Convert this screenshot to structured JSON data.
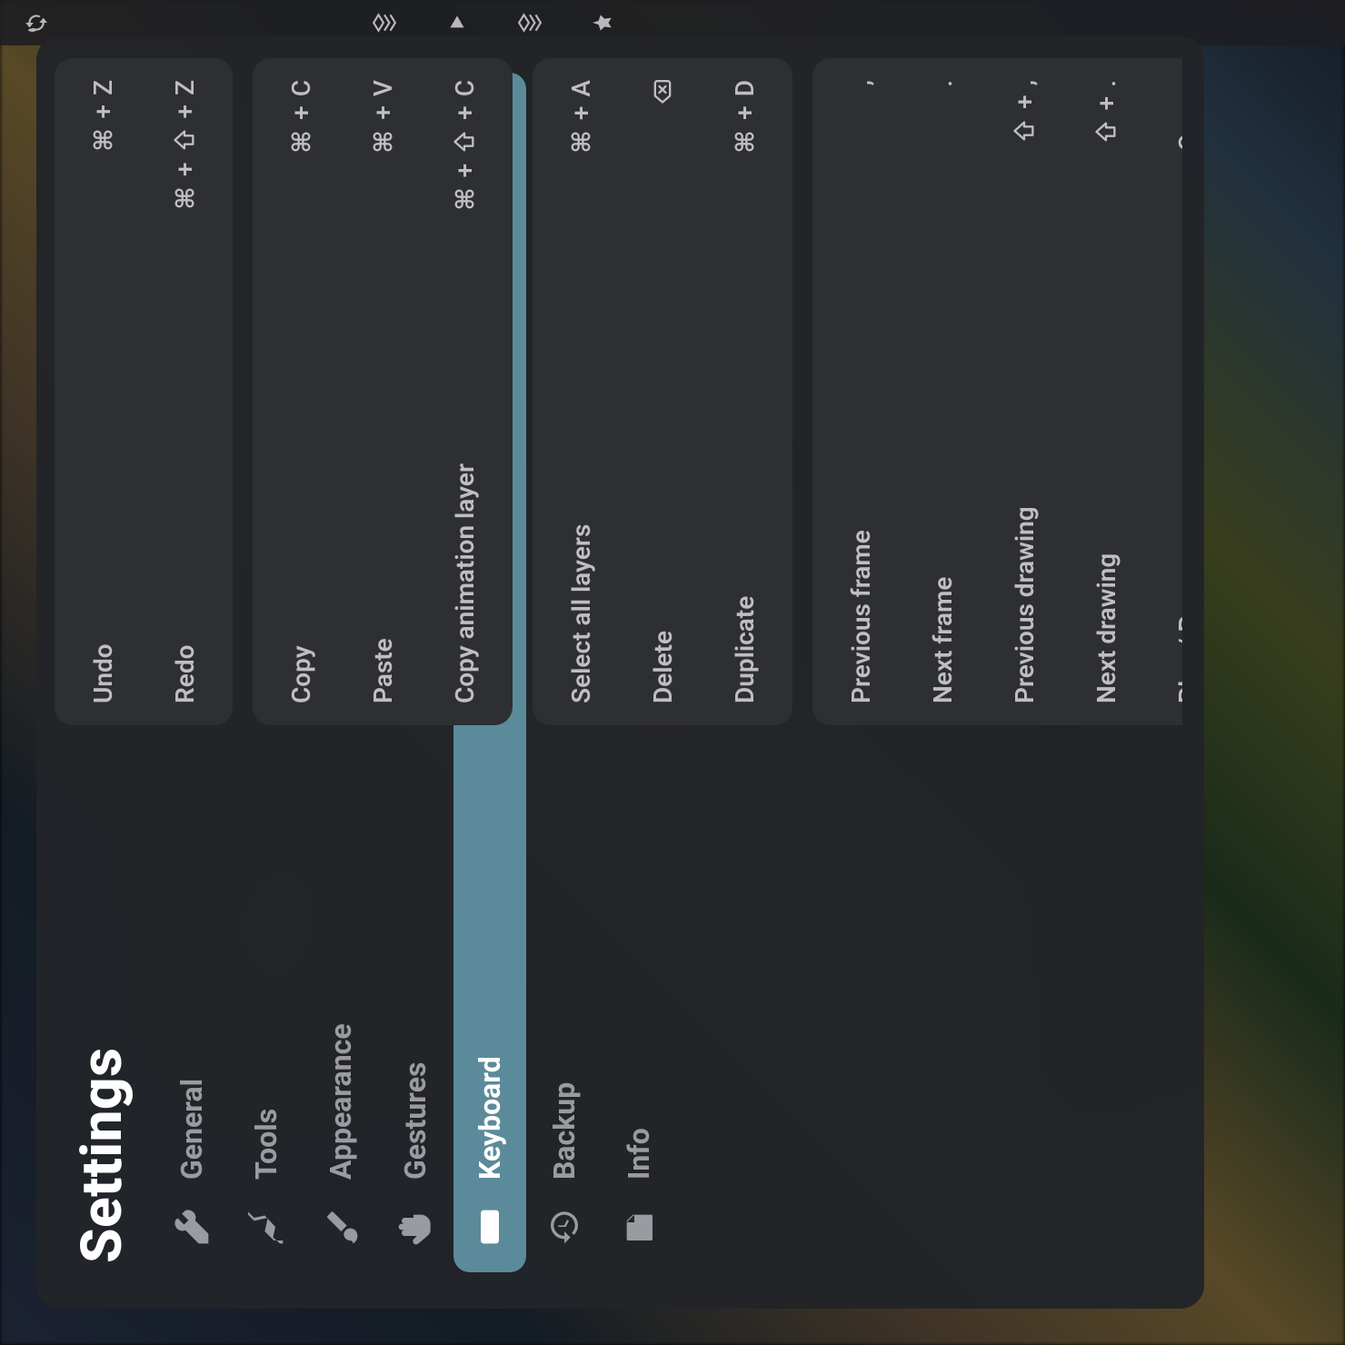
{
  "sidebar": {
    "title": "Settings",
    "items": [
      {
        "label": "General"
      },
      {
        "label": "Tools"
      },
      {
        "label": "Appearance"
      },
      {
        "label": "Gestures"
      },
      {
        "label": "Keyboard"
      },
      {
        "label": "Backup"
      },
      {
        "label": "Info"
      }
    ],
    "active_index": 4
  },
  "shortcut_groups": [
    {
      "rows": [
        {
          "label": "Undo",
          "keys": [
            "cmd",
            "+",
            "Z"
          ]
        },
        {
          "label": "Redo",
          "keys": [
            "cmd",
            "+",
            "shift",
            "+",
            "Z"
          ]
        }
      ]
    },
    {
      "rows": [
        {
          "label": "Copy",
          "keys": [
            "cmd",
            "+",
            "C"
          ]
        },
        {
          "label": "Paste",
          "keys": [
            "cmd",
            "+",
            "V"
          ]
        },
        {
          "label": "Copy animation layer",
          "keys": [
            "cmd",
            "+",
            "shift",
            "+",
            "C"
          ]
        }
      ]
    },
    {
      "rows": [
        {
          "label": "Select all layers",
          "keys": [
            "cmd",
            "+",
            "A"
          ]
        },
        {
          "label": "Delete",
          "keys": [
            "delete"
          ]
        },
        {
          "label": "Duplicate",
          "keys": [
            "cmd",
            "+",
            "D"
          ]
        }
      ]
    },
    {
      "rows": [
        {
          "label": "Previous frame",
          "keys": [
            ","
          ]
        },
        {
          "label": "Next frame",
          "keys": [
            "."
          ]
        },
        {
          "label": "Previous drawing",
          "keys": [
            "shift",
            "+",
            ","
          ]
        },
        {
          "label": "Next drawing",
          "keys": [
            "shift",
            "+",
            "."
          ]
        },
        {
          "label": "Play / Pause",
          "keys": [
            "Space"
          ]
        }
      ]
    }
  ]
}
